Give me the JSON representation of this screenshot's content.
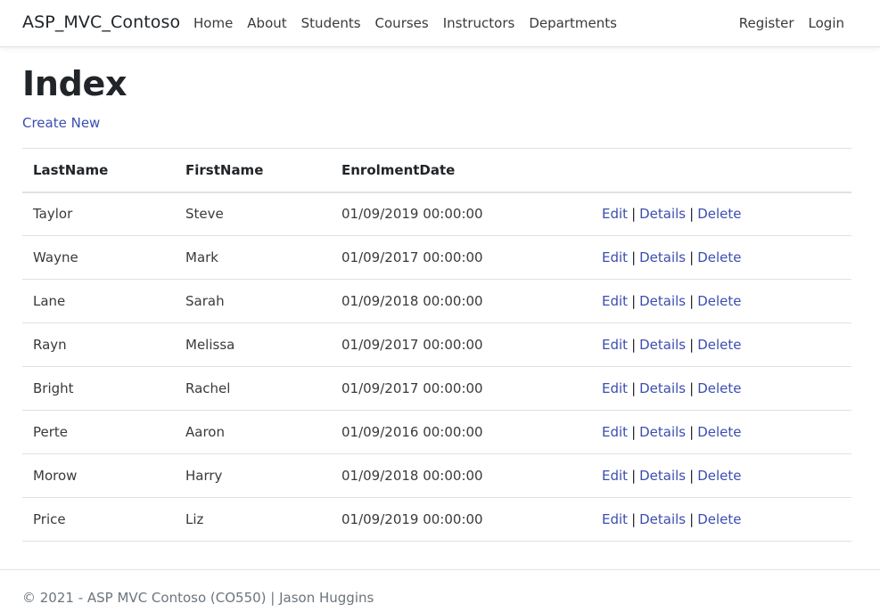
{
  "navbar": {
    "brand": "ASP_MVC_Contoso",
    "links": [
      "Home",
      "About",
      "Students",
      "Courses",
      "Instructors",
      "Departments"
    ],
    "right_links": [
      "Register",
      "Login"
    ]
  },
  "page": {
    "title": "Index",
    "create_label": "Create New"
  },
  "table": {
    "headers": [
      "LastName",
      "FirstName",
      "EnrolmentDate",
      ""
    ],
    "rows": [
      {
        "last": "Taylor",
        "first": "Steve",
        "date": "01/09/2019 00:00:00"
      },
      {
        "last": "Wayne",
        "first": "Mark",
        "date": "01/09/2017 00:00:00"
      },
      {
        "last": "Lane",
        "first": "Sarah",
        "date": "01/09/2018 00:00:00"
      },
      {
        "last": "Rayn",
        "first": "Melissa",
        "date": "01/09/2017 00:00:00"
      },
      {
        "last": "Bright",
        "first": "Rachel",
        "date": "01/09/2017 00:00:00"
      },
      {
        "last": "Perte",
        "first": "Aaron",
        "date": "01/09/2016 00:00:00"
      },
      {
        "last": "Morow",
        "first": "Harry",
        "date": "01/09/2018 00:00:00"
      },
      {
        "last": "Price",
        "first": "Liz",
        "date": "01/09/2019 00:00:00"
      }
    ],
    "actions": {
      "edit": "Edit",
      "details": "Details",
      "delete": "Delete",
      "separator": "|"
    }
  },
  "footer": {
    "text": "© 2021 - ASP MVC Contoso (CO550) | Jason Huggins"
  },
  "colors": {
    "link": "#3c4eb0",
    "text": "#212529",
    "muted": "#6c757d",
    "border": "#dee2e6"
  }
}
